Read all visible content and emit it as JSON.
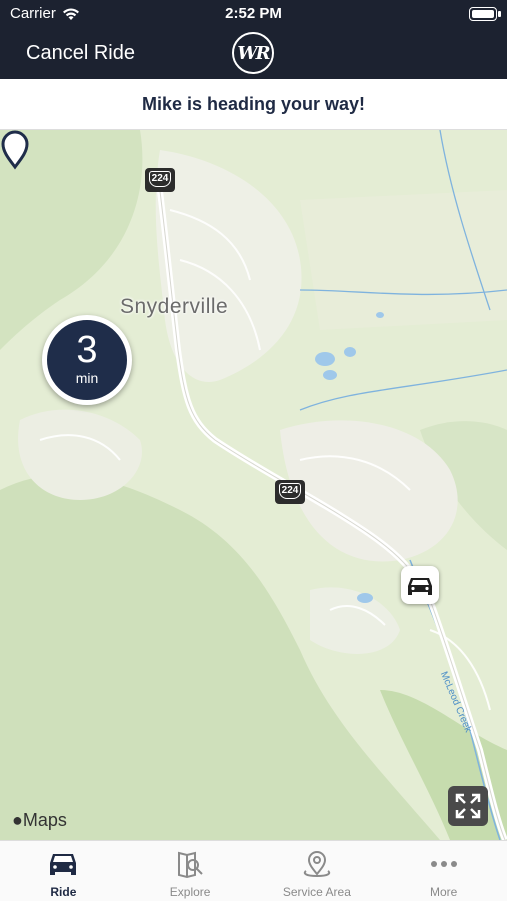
{
  "status_bar": {
    "carrier": "Carrier",
    "time": "2:52 PM"
  },
  "nav": {
    "cancel_label": "Cancel Ride",
    "logo_text": "WR"
  },
  "banner": {
    "message": "Mike is heading your way!"
  },
  "map": {
    "eta_value": "3",
    "eta_unit": "min",
    "town_label": "Snyderville",
    "route_shield_1": "224",
    "route_shield_2": "224",
    "creek_label": "McLeod Creek",
    "attribution": "Maps"
  },
  "tabs": [
    {
      "label": "Ride",
      "icon": "car-icon",
      "active": true
    },
    {
      "label": "Explore",
      "icon": "map-search-icon",
      "active": false
    },
    {
      "label": "Service Area",
      "icon": "map-pin-icon",
      "active": false
    },
    {
      "label": "More",
      "icon": "more-dots-icon",
      "active": false
    }
  ],
  "colors": {
    "header_bg": "#1c2230",
    "accent_navy": "#1f2d4a",
    "map_bg": "#e4edd4"
  }
}
